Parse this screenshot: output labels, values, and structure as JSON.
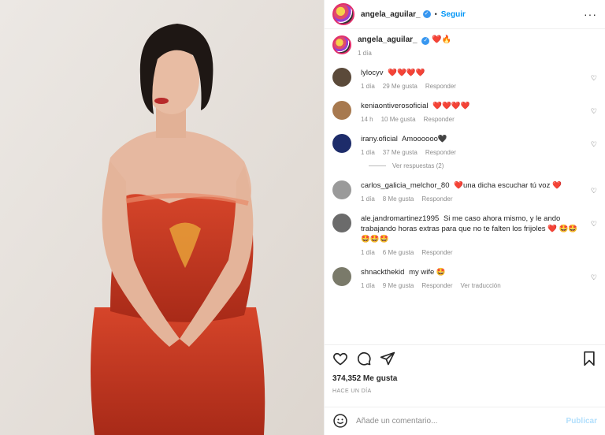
{
  "post": {
    "username": "angela_aguilar_",
    "follow_label": "Seguir",
    "more_label": "···",
    "caption_text": "❤️🔥",
    "caption_time": "1 día"
  },
  "comments": [
    {
      "user": "lylocyv",
      "text": "❤️❤️❤️❤️",
      "time": "1 día",
      "likes": "29 Me gusta",
      "reply": "Responder",
      "color": "#5b4a3a"
    },
    {
      "user": "keniaontiverosoficial",
      "text": "❤️❤️❤️❤️",
      "time": "14 h",
      "likes": "10 Me gusta",
      "reply": "Responder",
      "color": "#a7794f"
    },
    {
      "user": "irany.oficial",
      "text": "Amoooooo🖤",
      "time": "1 día",
      "likes": "37 Me gusta",
      "reply": "Responder",
      "color": "#1d2c6a"
    },
    {
      "user": "carlos_galicia_melchor_80",
      "text": "❤️una dicha escuchar tú voz ❤️",
      "time": "1 día",
      "likes": "8 Me gusta",
      "reply": "Responder",
      "color": "#9a9a9a"
    },
    {
      "user": "ale.jandromartinez1995",
      "text": "Si me caso ahora mismo, y le ando trabajando horas extras para que no te falten los frijoles ❤️ 🤩🤩🤩🤩🤩",
      "time": "1 día",
      "likes": "6 Me gusta",
      "reply": "Responder",
      "color": "#6b6b6b"
    },
    {
      "user": "shnackthekid",
      "text": "my wife 🤩",
      "time": "1 día",
      "likes": "9 Me gusta",
      "reply": "Responder",
      "extra": "Ver traducción",
      "color": "#7a7a6a"
    }
  ],
  "view_replies": "Ver respuestas (2)",
  "likes_count": "374,352 Me gusta",
  "posted_ago": "HACE UN DÍA",
  "composer": {
    "placeholder": "Añade un comentario...",
    "publish": "Publicar"
  },
  "colors": {
    "accent": "#0095f6",
    "verified": "#3897f0",
    "dress": "#c2381f"
  }
}
